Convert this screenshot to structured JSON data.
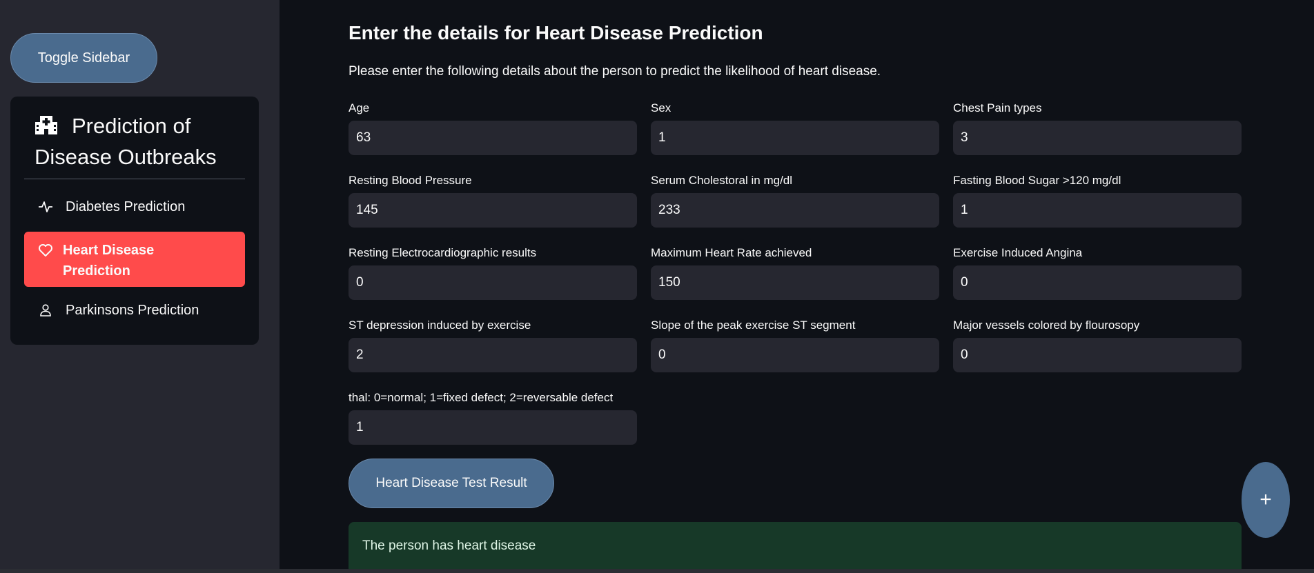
{
  "sidebar": {
    "toggle_label": "Toggle Sidebar",
    "menu_title": "Prediction of Disease Outbreaks",
    "title_icon": "hospital-icon",
    "items": [
      {
        "label": "Diabetes Prediction",
        "icon": "activity-icon",
        "active": false
      },
      {
        "label": "Heart Disease Prediction",
        "icon": "heart-icon",
        "active": true
      },
      {
        "label": "Parkinsons Prediction",
        "icon": "person-icon",
        "active": false
      }
    ],
    "active_color": "#ff4b4b"
  },
  "main": {
    "heading": "Enter the details for Heart Disease Prediction",
    "subtext": "Please enter the following details about the person to predict the likelihood of heart disease.",
    "fields": [
      {
        "label": "Age",
        "value": "63"
      },
      {
        "label": "Sex",
        "value": "1"
      },
      {
        "label": "Chest Pain types",
        "value": "3"
      },
      {
        "label": "Resting Blood Pressure",
        "value": "145"
      },
      {
        "label": "Serum Cholestoral in mg/dl",
        "value": "233"
      },
      {
        "label": "Fasting Blood Sugar >120 mg/dl",
        "value": "1"
      },
      {
        "label": "Resting Electrocardiographic results",
        "value": "0"
      },
      {
        "label": "Maximum Heart Rate achieved",
        "value": "150"
      },
      {
        "label": "Exercise Induced Angina",
        "value": "0"
      },
      {
        "label": "ST depression induced by exercise",
        "value": "2"
      },
      {
        "label": "Slope of the peak exercise ST segment",
        "value": "0"
      },
      {
        "label": "Major vessels colored by flourosopy",
        "value": "0"
      },
      {
        "label": "thal: 0=normal; 1=fixed defect; 2=reversable defect",
        "value": "1"
      }
    ],
    "result_button": "Heart Disease Test Result",
    "result_message": "The person has heart disease",
    "fab_label": "+"
  },
  "colors": {
    "background": "#0e1117",
    "sidebar": "#262730",
    "button": "#4a6b8e",
    "success_bg": "#173928"
  }
}
